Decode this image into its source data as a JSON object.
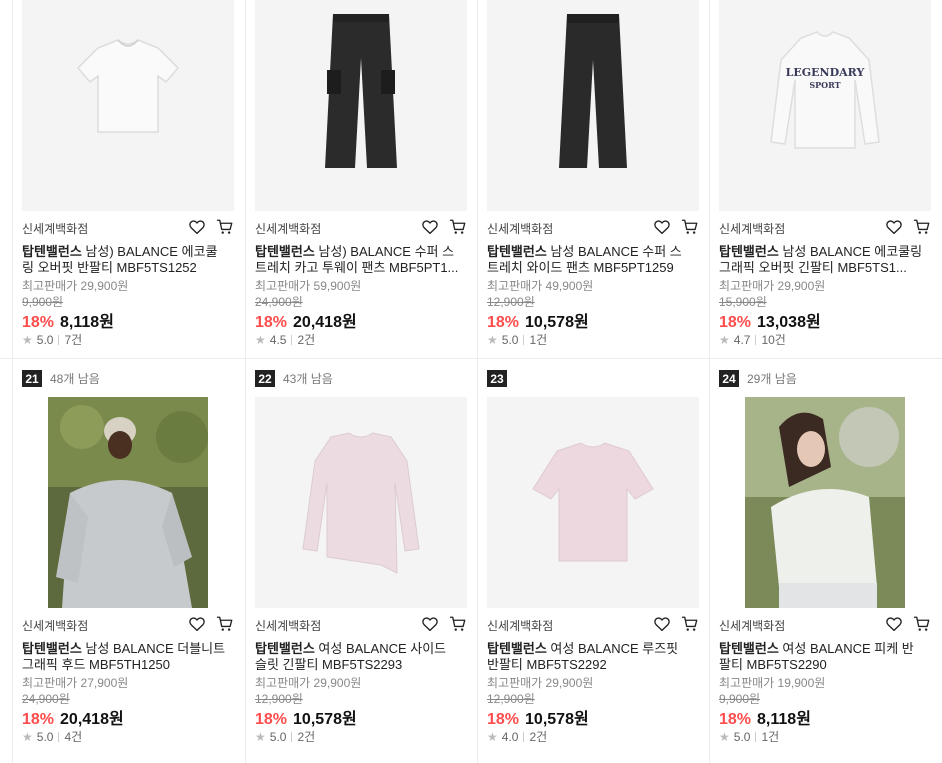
{
  "products": [
    {
      "rank": "",
      "remain": "",
      "store": "신세계백화점",
      "brand": "탑텐밸런스",
      "name": " 남성) BALANCE 에코쿨링 오버핏 반팔티 MBF5TS1252",
      "orig_label": "최고판매가 29,900원",
      "strike": "9,900원",
      "discount": "18%",
      "price": "8,118원",
      "rating": "5.0",
      "reviews": "7건",
      "img": "white-tee"
    },
    {
      "rank": "",
      "remain": "",
      "store": "신세계백화점",
      "brand": "탑텐밸런스",
      "name": " 남성) BALANCE 수퍼 스트레치 카고 투웨이 팬츠 MBF5PT1...",
      "orig_label": "최고판매가 59,900원",
      "strike": "24,900원",
      "discount": "18%",
      "price": "20,418원",
      "rating": "4.5",
      "reviews": "2건",
      "img": "cargo-pants"
    },
    {
      "rank": "",
      "remain": "",
      "store": "신세계백화점",
      "brand": "탑텐밸런스",
      "name": " 남성 BALANCE 수퍼 스트레치 와이드 팬츠 MBF5PT1259",
      "orig_label": "최고판매가 49,900원",
      "strike": "12,900원",
      "discount": "18%",
      "price": "10,578원",
      "rating": "5.0",
      "reviews": "1건",
      "img": "wide-pants"
    },
    {
      "rank": "",
      "remain": "",
      "store": "신세계백화점",
      "brand": "탑텐밸런스",
      "name": " 남성 BALANCE 에코쿨링 그래픽 오버핏 긴팔티 MBF5TS1...",
      "orig_label": "최고판매가 29,900원",
      "strike": "15,900원",
      "discount": "18%",
      "price": "13,038원",
      "rating": "4.7",
      "reviews": "10건",
      "img": "graphic-longsleeve"
    },
    {
      "rank": "21",
      "remain": "48개 남음",
      "store": "신세계백화점",
      "brand": "탑텐밸런스",
      "name": " 남성 BALANCE 더블니트 그래픽 후드 MBF5TH1250",
      "orig_label": "최고판매가 27,900원",
      "strike": "24,900원",
      "discount": "18%",
      "price": "20,418원",
      "rating": "5.0",
      "reviews": "4건",
      "img": "hoodie-model"
    },
    {
      "rank": "22",
      "remain": "43개 남음",
      "store": "신세계백화점",
      "brand": "탑텐밸런스",
      "name": " 여성 BALANCE 사이드 슬릿 긴팔티 MBF5TS2293",
      "orig_label": "최고판매가 29,900원",
      "strike": "12,900원",
      "discount": "18%",
      "price": "10,578원",
      "rating": "5.0",
      "reviews": "2건",
      "img": "pink-longsleeve"
    },
    {
      "rank": "23",
      "remain": "",
      "store": "신세계백화점",
      "brand": "탑텐밸런스",
      "name": " 여성 BALANCE 루즈핏 반팔티 MBF5TS2292",
      "orig_label": "최고판매가 29,900원",
      "strike": "12,900원",
      "discount": "18%",
      "price": "10,578원",
      "rating": "4.0",
      "reviews": "2건",
      "img": "pink-tee"
    },
    {
      "rank": "24",
      "remain": "29개 남음",
      "store": "신세계백화점",
      "brand": "탑텐밸런스",
      "name": " 여성 BALANCE 피케 반팔티 MBF5TS2290",
      "orig_label": "최고판매가 19,900원",
      "strike": "9,900원",
      "discount": "18%",
      "price": "8,118원",
      "rating": "5.0",
      "reviews": "1건",
      "img": "woman-model"
    }
  ],
  "icons": {
    "wish": "heart-icon",
    "cart": "cart-icon",
    "star": "star-icon"
  },
  "colors": {
    "discount": "#ff4d4d",
    "rank_badge": "#222222"
  }
}
